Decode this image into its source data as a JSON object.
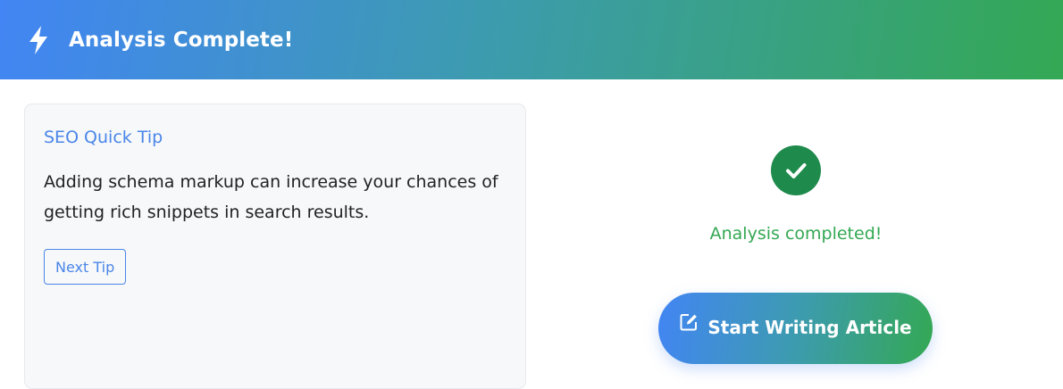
{
  "header": {
    "title": "Analysis Complete!",
    "icon": "lightning-bolt-icon",
    "gradient_start": "#4285f4",
    "gradient_end": "#34a853"
  },
  "tip": {
    "title": "SEO Quick Tip",
    "body": "Adding schema markup can increase your chances of getting rich snippets in search results.",
    "next_label": "Next Tip"
  },
  "status": {
    "icon": "check-circle-icon",
    "text": "Analysis completed!",
    "color": "#34a853"
  },
  "actions": {
    "start_label": "Start Writing Article",
    "start_icon": "edit-icon"
  }
}
